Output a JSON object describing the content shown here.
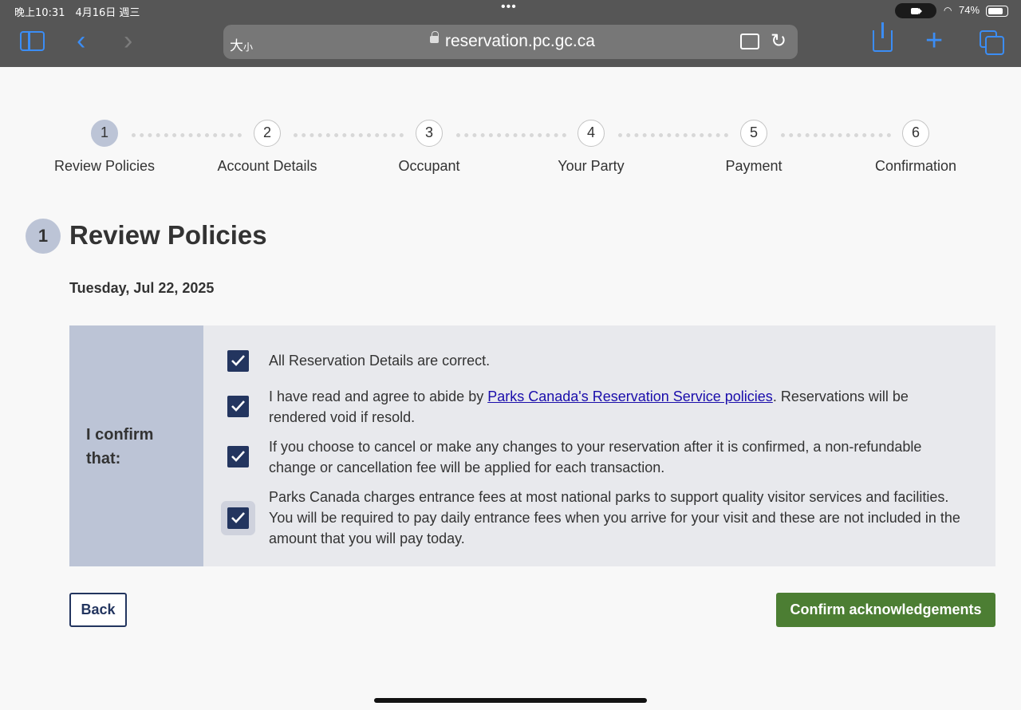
{
  "status_bar": {
    "time": "晚上10:31　4月16日 週三",
    "dots": "•••",
    "battery": "74%"
  },
  "browser": {
    "reader_label_big": "大",
    "reader_label_small": "小",
    "url": "reservation.pc.gc.ca",
    "reload_glyph": "↻",
    "back_glyph": "‹",
    "forward_glyph": "›",
    "new_tab_glyph": "+"
  },
  "stepper": {
    "steps": [
      {
        "number": "1",
        "label": "Review Policies",
        "active": true
      },
      {
        "number": "2",
        "label": "Account Details"
      },
      {
        "number": "3",
        "label": "Occupant"
      },
      {
        "number": "4",
        "label": "Your Party"
      },
      {
        "number": "5",
        "label": "Payment"
      },
      {
        "number": "6",
        "label": "Confirmation"
      }
    ]
  },
  "section": {
    "number": "1",
    "title": "Review Policies",
    "date": "Tuesday, Jul 22, 2025"
  },
  "confirm": {
    "side_label": "I confirm that:",
    "items": [
      {
        "checked": true,
        "text": "All Reservation Details are correct."
      },
      {
        "checked": true,
        "pre": "I have read and agree to abide by ",
        "link": "Parks Canada's Reservation Service policies",
        "post": ". Reservations will be rendered void if resold."
      },
      {
        "checked": true,
        "text": "If you choose to cancel or make any changes to your reservation after it is confirmed, a non-refundable change or cancellation fee will be applied for each transaction."
      },
      {
        "checked": true,
        "text": "Parks Canada charges entrance fees at most national parks to support quality visitor services and facilities. You will be required to pay daily entrance fees when you arrive for your visit and these are not included in the amount that you will pay today."
      }
    ]
  },
  "buttons": {
    "back": "Back",
    "confirm": "Confirm acknowledgements"
  },
  "colors": {
    "primary_navy": "#23355f",
    "confirm_green": "#4c7e33",
    "active_step": "#bcc4d6",
    "link": "#1a0dab"
  }
}
